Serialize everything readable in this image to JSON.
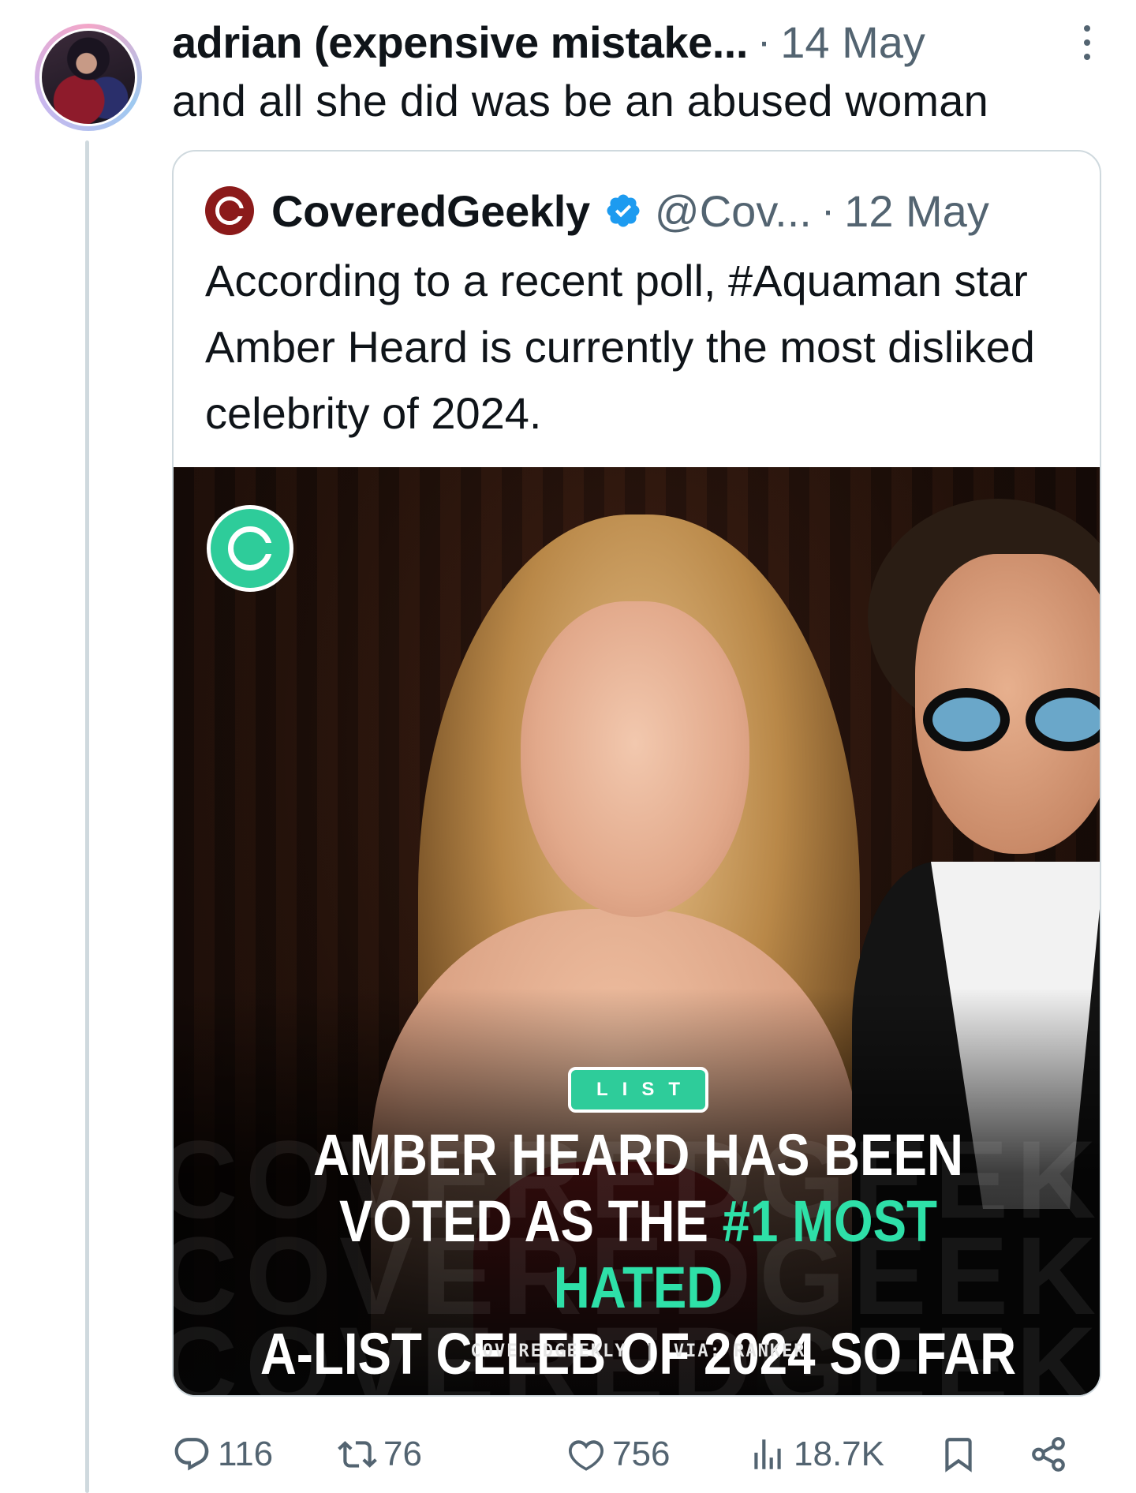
{
  "tweet": {
    "display_name": "adrian (expensive mistake...",
    "date": "14 May",
    "text": "and all she did was be an abused woman"
  },
  "quote": {
    "name": "CoveredGeekly",
    "handle": "@Cov...",
    "date": "12 May",
    "verified": true,
    "text": "According to a recent poll, #Aquaman star Amber Heard is currently the most disliked celebrity of 2024.",
    "media": {
      "badge": "LIST",
      "headline_1": "AMBER HEARD HAS BEEN",
      "headline_2a": "VOTED AS THE ",
      "headline_2b": "#1 MOST HATED",
      "headline_3": "A-LIST CELEB OF 2024 SO FAR",
      "footer_source": "COVEREDGEEKLY",
      "footer_via": "VIA: RANKER",
      "watermark": "COVEREDGEEKLY",
      "accent_color": "#2ee0a8"
    }
  },
  "actions": {
    "replies": "116",
    "reposts": "76",
    "likes": "756",
    "views": "18.7K"
  },
  "icons": [
    "more-icon",
    "verified-icon",
    "reply-icon",
    "repost-icon",
    "like-icon",
    "views-icon",
    "bookmark-icon",
    "share-icon"
  ]
}
